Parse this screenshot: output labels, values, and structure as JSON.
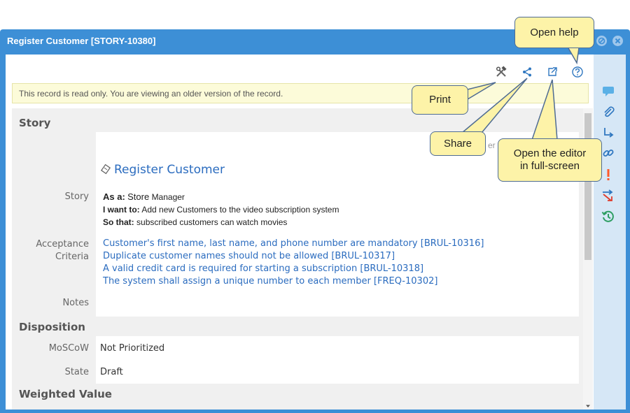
{
  "window": {
    "title": "Register Customer [STORY-10380]"
  },
  "notice": "This record is read only. You are viewing an older version of the record.",
  "sections": {
    "story": "Story",
    "disposition": "Disposition",
    "weighted_value": "Weighted Value"
  },
  "story": {
    "name": "Register Customer",
    "label": "Story",
    "as_a_label": "As a:",
    "as_a_role": "Store",
    "as_a_value": "Manager",
    "want_label": "I want to:",
    "want_value": "Add new Customers to the video subscription system",
    "so_that_label": "So that:",
    "so_that_value": "subscribed customers can watch movies",
    "partial_text": "er"
  },
  "acceptance": {
    "label_line1": "Acceptance",
    "label_line2": "Criteria",
    "items": [
      "Customer's first name, last name, and phone number are mandatory [BRUL-10316]",
      "Duplicate customer names should not be allowed [BRUL-10317]",
      "A valid credit card is required for starting a subscription [BRUL-10318]",
      "The system shall assign a unique number to each member [FREQ-10302]"
    ]
  },
  "notes": {
    "label": "Notes"
  },
  "disposition": {
    "moscow_label": "MoSCoW",
    "moscow_value": "Not Prioritized",
    "state_label": "State",
    "state_value": "Draft"
  },
  "callouts": {
    "help": "Open help",
    "print": "Print",
    "share": "Share",
    "fullscreen_line1": "Open the editor",
    "fullscreen_line2": "in full-screen"
  },
  "icons": {
    "toolbar": [
      "tools-icon",
      "share-icon",
      "external-link-icon",
      "help-icon"
    ],
    "rightbar": [
      "comment-icon",
      "attachment-icon",
      "trace-icon",
      "link-icon",
      "alert-icon",
      "flow-icon",
      "history-icon"
    ]
  },
  "colors": {
    "frame": "#3d8fd6",
    "link": "#2b6cbf",
    "callout_bg": "#fdf3a8",
    "notice_bg": "#fcfbd9"
  }
}
